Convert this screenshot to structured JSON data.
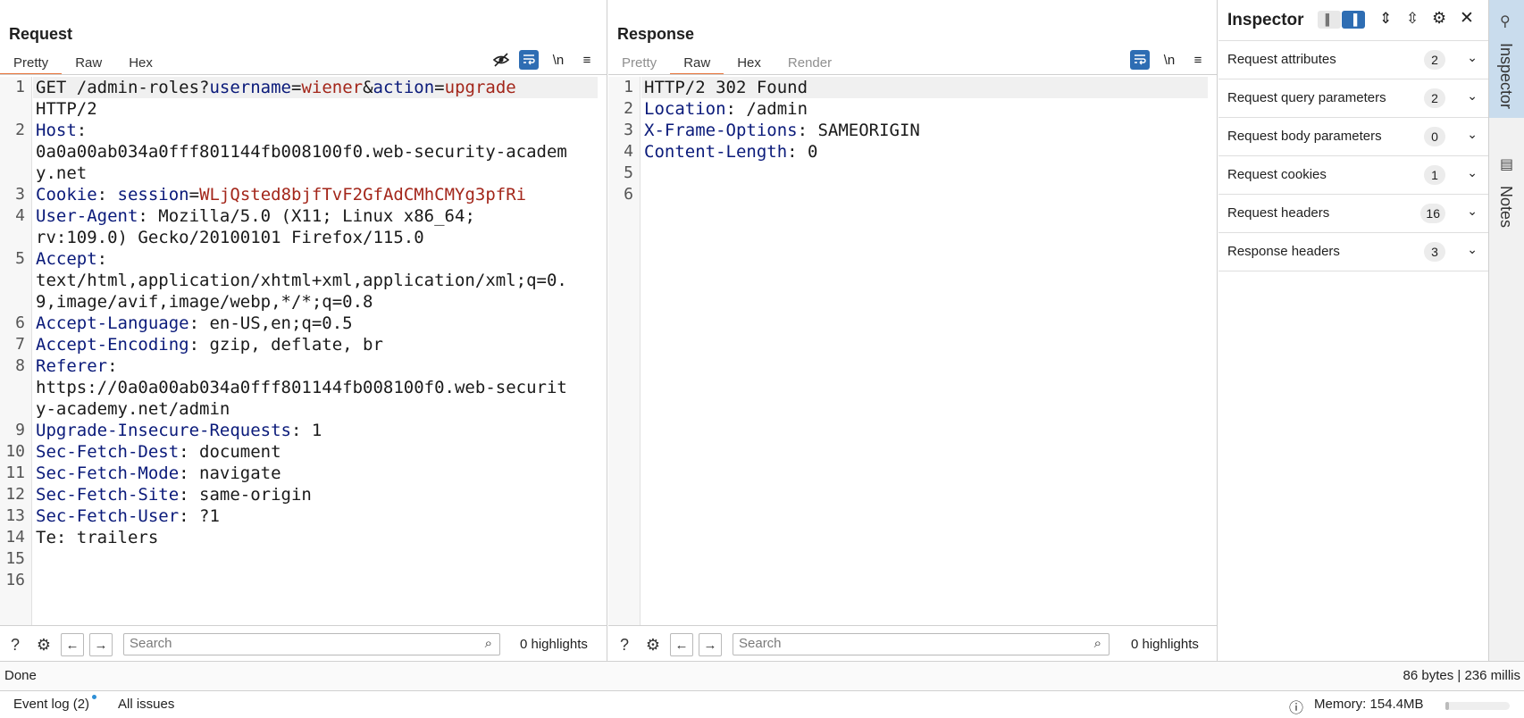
{
  "layout_toggle": {
    "icons": [
      "columns-icon",
      "rows-icon",
      "single-icon"
    ]
  },
  "request": {
    "title": "Request",
    "tabs": [
      "Pretty",
      "Raw",
      "Hex"
    ],
    "active_tab": "Pretty",
    "toolbar_icons": [
      "hide-icon",
      "wrap-icon",
      "newline-icon",
      "menu-icon"
    ],
    "newline_label": "\\n",
    "line_numbers": [
      "1",
      "2",
      "3",
      "4",
      "5",
      "6",
      "7",
      "8",
      "9",
      "10",
      "11",
      "12",
      "13",
      "14",
      "15",
      "16"
    ],
    "lines": [
      {
        "n": 0,
        "segs": [
          [
            "",
            "GET /admin-roles?"
          ],
          [
            "k",
            "username"
          ],
          [
            "",
            "="
          ],
          [
            "v",
            "wiener"
          ],
          [
            "",
            "&"
          ],
          [
            "k",
            "action"
          ],
          [
            "",
            "="
          ],
          [
            "v",
            "upgrade"
          ]
        ]
      },
      {
        "n": null,
        "segs": [
          [
            "",
            "HTTP/2"
          ]
        ]
      },
      {
        "n": 1,
        "segs": [
          [
            "k",
            "Host"
          ],
          [
            "",
            ":"
          ]
        ]
      },
      {
        "n": null,
        "segs": [
          [
            "",
            "0a0a00ab034a0fff801144fb008100f0.web-security-academ"
          ]
        ]
      },
      {
        "n": null,
        "segs": [
          [
            "",
            "y.net"
          ]
        ]
      },
      {
        "n": 2,
        "segs": [
          [
            "k",
            "Cookie"
          ],
          [
            "",
            ": "
          ],
          [
            "k",
            "session"
          ],
          [
            "",
            "="
          ],
          [
            "v",
            "WLjQsted8bjfTvF2GfAdCMhCMYg3pfRi"
          ]
        ]
      },
      {
        "n": 3,
        "segs": [
          [
            "k",
            "User-Agent"
          ],
          [
            "",
            ": Mozilla/5.0 (X11; Linux x86_64;"
          ]
        ]
      },
      {
        "n": null,
        "segs": [
          [
            "",
            "rv:109.0) Gecko/20100101 Firefox/115.0"
          ]
        ]
      },
      {
        "n": 4,
        "segs": [
          [
            "k",
            "Accept"
          ],
          [
            "",
            ":"
          ]
        ]
      },
      {
        "n": null,
        "segs": [
          [
            "",
            "text/html,application/xhtml+xml,application/xml;q=0."
          ]
        ]
      },
      {
        "n": null,
        "segs": [
          [
            "",
            "9,image/avif,image/webp,*/*;q=0.8"
          ]
        ]
      },
      {
        "n": 5,
        "segs": [
          [
            "k",
            "Accept-Language"
          ],
          [
            "",
            ": en-US,en;q=0.5"
          ]
        ]
      },
      {
        "n": 6,
        "segs": [
          [
            "k",
            "Accept-Encoding"
          ],
          [
            "",
            ": gzip, deflate, br"
          ]
        ]
      },
      {
        "n": 7,
        "segs": [
          [
            "k",
            "Referer"
          ],
          [
            "",
            ":"
          ]
        ]
      },
      {
        "n": null,
        "segs": [
          [
            "",
            "https://0a0a00ab034a0fff801144fb008100f0.web-securit"
          ]
        ]
      },
      {
        "n": null,
        "segs": [
          [
            "",
            "y-academy.net/admin"
          ]
        ]
      },
      {
        "n": 8,
        "segs": [
          [
            "k",
            "Upgrade-Insecure-Requests"
          ],
          [
            "",
            ": 1"
          ]
        ]
      },
      {
        "n": 9,
        "segs": [
          [
            "k",
            "Sec-Fetch-Dest"
          ],
          [
            "",
            ": document"
          ]
        ]
      },
      {
        "n": 10,
        "segs": [
          [
            "k",
            "Sec-Fetch-Mode"
          ],
          [
            "",
            ": navigate"
          ]
        ]
      },
      {
        "n": 11,
        "segs": [
          [
            "k",
            "Sec-Fetch-Site"
          ],
          [
            "",
            ": same-origin"
          ]
        ]
      },
      {
        "n": 12,
        "segs": [
          [
            "k",
            "Sec-Fetch-User"
          ],
          [
            "",
            ": ?1"
          ]
        ]
      },
      {
        "n": 13,
        "segs": [
          [
            "",
            "Te: trailers"
          ]
        ]
      },
      {
        "n": 14,
        "segs": [
          [
            "",
            ""
          ]
        ]
      },
      {
        "n": 15,
        "segs": [
          [
            "",
            ""
          ]
        ]
      }
    ],
    "search_placeholder": "Search",
    "highlights": "0 highlights"
  },
  "response": {
    "title": "Response",
    "tabs": [
      "Pretty",
      "Raw",
      "Hex",
      "Render"
    ],
    "active_tab": "Raw",
    "disabled_tabs": [
      "Pretty",
      "Render"
    ],
    "toolbar_icons": [
      "wrap-icon",
      "newline-icon",
      "menu-icon"
    ],
    "newline_label": "\\n",
    "line_numbers": [
      "1",
      "2",
      "3",
      "4",
      "5",
      "6"
    ],
    "lines": [
      {
        "n": 0,
        "segs": [
          [
            "",
            "HTTP/2 302 Found"
          ]
        ]
      },
      {
        "n": 1,
        "segs": [
          [
            "k",
            "Location"
          ],
          [
            "",
            ": /admin"
          ]
        ]
      },
      {
        "n": 2,
        "segs": [
          [
            "k",
            "X-Frame-Options"
          ],
          [
            "",
            ": SAMEORIGIN"
          ]
        ]
      },
      {
        "n": 3,
        "segs": [
          [
            "k",
            "Content-Length"
          ],
          [
            "",
            ": 0"
          ]
        ]
      },
      {
        "n": 4,
        "segs": [
          [
            "",
            ""
          ]
        ]
      },
      {
        "n": 5,
        "segs": [
          [
            "",
            ""
          ]
        ]
      }
    ],
    "search_placeholder": "Search",
    "highlights": "0 highlights"
  },
  "inspector": {
    "title": "Inspector",
    "rows": [
      {
        "label": "Request attributes",
        "count": "2"
      },
      {
        "label": "Request query parameters",
        "count": "2"
      },
      {
        "label": "Request body parameters",
        "count": "0"
      },
      {
        "label": "Request cookies",
        "count": "1"
      },
      {
        "label": "Request headers",
        "count": "16"
      },
      {
        "label": "Response headers",
        "count": "3"
      }
    ]
  },
  "rail": {
    "tabs": [
      {
        "label": "Inspector",
        "active": true
      },
      {
        "label": "Notes",
        "active": false
      }
    ]
  },
  "status": {
    "left": "Done",
    "right": "86 bytes | 236 millis"
  },
  "footer": {
    "event_log": "Event log (2)",
    "all_issues": "All issues",
    "memory": "Memory: 154.4MB",
    "memory_used_fraction": 0.05
  },
  "colors": {
    "accent": "#e8743b",
    "active_blue": "#2e6db3",
    "key": "#0a1a7a",
    "value": "#a3261a"
  }
}
